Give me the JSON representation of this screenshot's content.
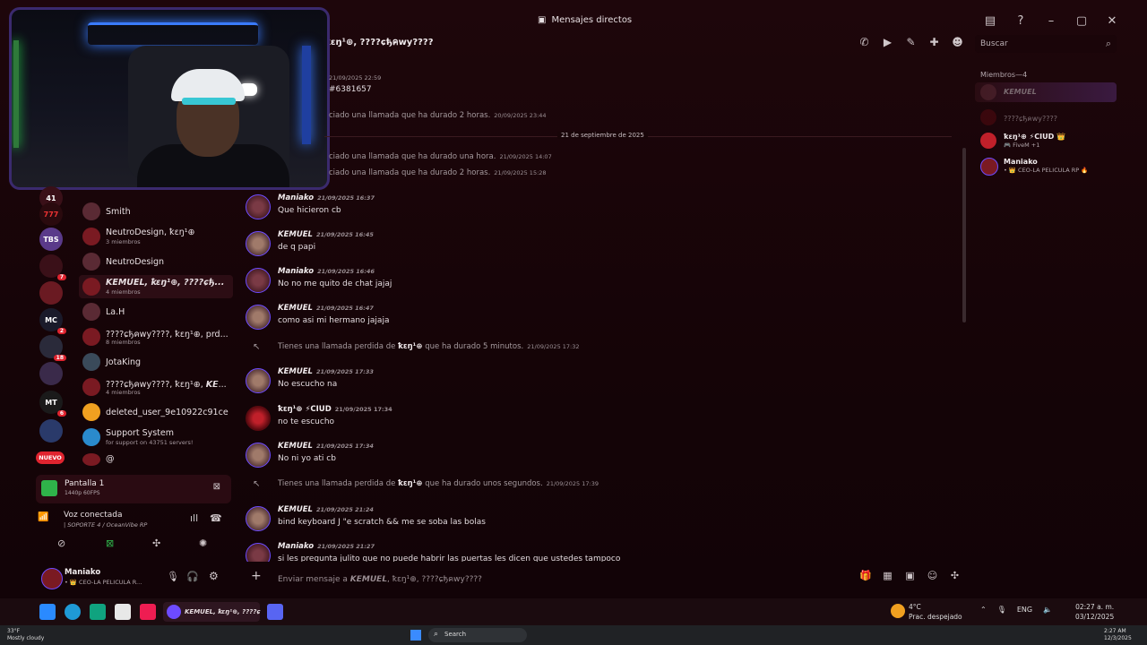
{
  "window": {
    "title": "Mensajes directos",
    "channel_title": "ꝁɛŋ¹⊕, ????ɕђคwy????",
    "search_placeholder": "Buscar"
  },
  "sidebar": {
    "servers": [
      {
        "label": "41",
        "badge": ""
      },
      {
        "label": "777",
        "badge": ""
      },
      {
        "label": "TBS",
        "badge": ""
      },
      {
        "label": "",
        "badge": "7"
      },
      {
        "label": "",
        "badge": ""
      },
      {
        "label": "MC",
        "badge": "2"
      },
      {
        "label": "",
        "badge": "18"
      },
      {
        "label": "",
        "badge": ""
      },
      {
        "label": "MT",
        "badge": "6"
      },
      {
        "label": "",
        "badge": ""
      },
      {
        "label": "NUEVO",
        "badge": ""
      }
    ],
    "dms": [
      {
        "name": "Smith",
        "sub": ""
      },
      {
        "name": "NeutroDesign, ꝁɛŋ¹⊕",
        "sub": "3 miembros"
      },
      {
        "name": "NeutroDesign",
        "sub": ""
      },
      {
        "name": "𝙆𝙀𝙈𝙐𝙀𝙇, ꝁɛŋ¹⊕, ????ɕђ...",
        "sub": "4 miembros"
      },
      {
        "name": "La.H",
        "sub": ""
      },
      {
        "name": "????ɕђคwy????, ꝁɛŋ¹⊕, prd...",
        "sub": "8 miembros"
      },
      {
        "name": "JotaKing",
        "sub": ""
      },
      {
        "name": "????ɕђคwy????, ꝁɛŋ¹⊕, 𝙆𝙀...",
        "sub": "4 miembros"
      },
      {
        "name": "deleted_user_9e10922c91ce",
        "sub": ""
      },
      {
        "name": "Support System",
        "sub": "for support on 43751 servers!"
      },
      {
        "name": "@",
        "sub": ""
      }
    ]
  },
  "voice": {
    "screen_title": "Pantalla 1",
    "screen_sub": "1440p 60FPS",
    "status": "Voz conectada",
    "channel": "| SOPORTE 4 / OceanVibe RP"
  },
  "user": {
    "name": "Maniako",
    "status": "• 👑 CEO-LA PELICULA R..."
  },
  "messages": {
    "sys_top": [
      {
        "text": "21/09/2025 22:59",
        "ts": ""
      },
      {
        "text": "#6381657",
        "ts": ""
      },
      {
        "text": "ciado una llamada que ha durado 2 horas.",
        "ts": "20/09/2025 23:44"
      }
    ],
    "divider": "21 de septiembre de 2025",
    "sys_mid": [
      {
        "text": "ciado una llamada que ha durado una hora.",
        "ts": "21/09/2025 14:07"
      },
      {
        "text": "ciado una llamada que ha durado 2 horas.",
        "ts": "21/09/2025 15:28"
      }
    ],
    "items": [
      {
        "author": "Maniako",
        "ts": "21/09/2025 16:37",
        "body": "Que hicieron cb"
      },
      {
        "author": "𝙆𝙀𝙈𝙐𝙀𝙇",
        "ts": "21/09/2025 16:45",
        "body": "de q papi"
      },
      {
        "author": "Maniako",
        "ts": "21/09/2025 16:46",
        "body": "No no me quito de chat jajaj"
      },
      {
        "author": "𝙆𝙀𝙈𝙐𝙀𝙇",
        "ts": "21/09/2025 16:47",
        "body": "como asi mi hermano jajaja"
      },
      {
        "author": "𝙆𝙀𝙈𝙐𝙀𝙇",
        "ts": "21/09/2025 17:33",
        "body": "No escucho na"
      },
      {
        "author": "ꝁɛŋ¹⊕ ⚡CIUD",
        "ts": "21/09/2025 17:34",
        "body": "no te escucho"
      },
      {
        "author": "𝙆𝙀𝙈𝙐𝙀𝙇",
        "ts": "21/09/2025 17:34",
        "body": "No ni yo ati cb"
      },
      {
        "author": "𝙆𝙀𝙈𝙐𝙀𝙇",
        "ts": "21/09/2025 21:24",
        "body": "bind keyboard J \"e scratch && me se soba las bolas"
      },
      {
        "author": "Maniako",
        "ts": "21/09/2025 21:27",
        "body": "si les pregunta julito que no puede habrir las puertas les dicen que ustedes tampoco"
      }
    ],
    "missed": [
      {
        "pre": "Tienes una llamada perdida de",
        "who": "ꝁɛŋ¹⊕",
        "post": "que ha durado 5 minutos.",
        "ts": "21/09/2025 17:32"
      },
      {
        "pre": "Tienes una llamada perdida de",
        "who": "ꝁɛŋ¹⊕",
        "post": "que ha durado unos segundos.",
        "ts": "21/09/2025 17:39"
      }
    ]
  },
  "members": {
    "header": "Miembros—4",
    "list": [
      {
        "name": "𝙆𝙀𝙈𝙐𝙀𝙇",
        "sub": ""
      },
      {
        "name": "????ɕђคwy????",
        "sub": ""
      },
      {
        "name": "ꝁɛŋ¹⊕ ⚡CIUD 👑",
        "sub": "🎮 FiveM +1"
      },
      {
        "name": "Maniako",
        "sub": "• 👑 CEO-LA PELICULA RP 🔥"
      }
    ]
  },
  "composer": {
    "placeholder": "Enviar mensaje a 𝙆𝙀𝙈𝙐𝙀𝙇, ꝁɛŋ¹⊕, ????ɕђคwy????"
  },
  "appbar": {
    "active_task": "𝙆𝙀𝙈𝙐𝙀𝙇, ꝁɛŋ¹⊕, ????ɕ",
    "weather_temp": "4°C",
    "weather_desc": "Prac. despejado",
    "lang": "ENG",
    "time": "02:27 a. m.",
    "date": "03/12/2025"
  },
  "winbar": {
    "temp": "33°F",
    "cond": "Mostly cloudy",
    "search": "Search",
    "time": "2:27 AM",
    "date": "12/3/2025"
  },
  "colors": {
    "accent": "#6d4bff",
    "bg": "#150407",
    "badge": "#e0242f"
  }
}
